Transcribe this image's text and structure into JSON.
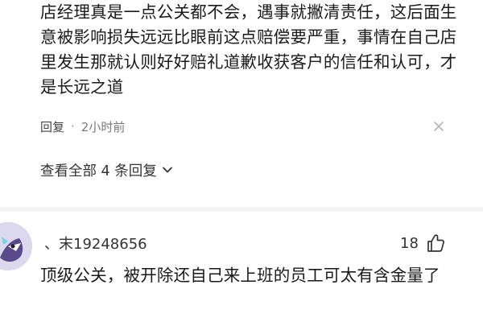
{
  "comment1": {
    "text": "店经理真是一点公关都不会，遇事就撇清责任，这后面生意被影响损失远远比眼前这点赔偿要严重，事情在自己店里发生那就认则好好赔礼道歉收获客户的信任和认可，才是长远之道",
    "reply_label": "回复",
    "separator": "·",
    "timestamp": "2小时前",
    "close_icon": "close-icon"
  },
  "replies": {
    "view_all_label": "查看全部 4 条回复",
    "chevron_icon": "chevron-down-icon"
  },
  "comment2": {
    "username": "、末19248656",
    "like_count": "18",
    "like_icon": "thumbs-up-icon",
    "text": "顶级公关，被开除还自己来上班的员工可太有含金量了",
    "avatar_color": "#dcd9ef"
  }
}
